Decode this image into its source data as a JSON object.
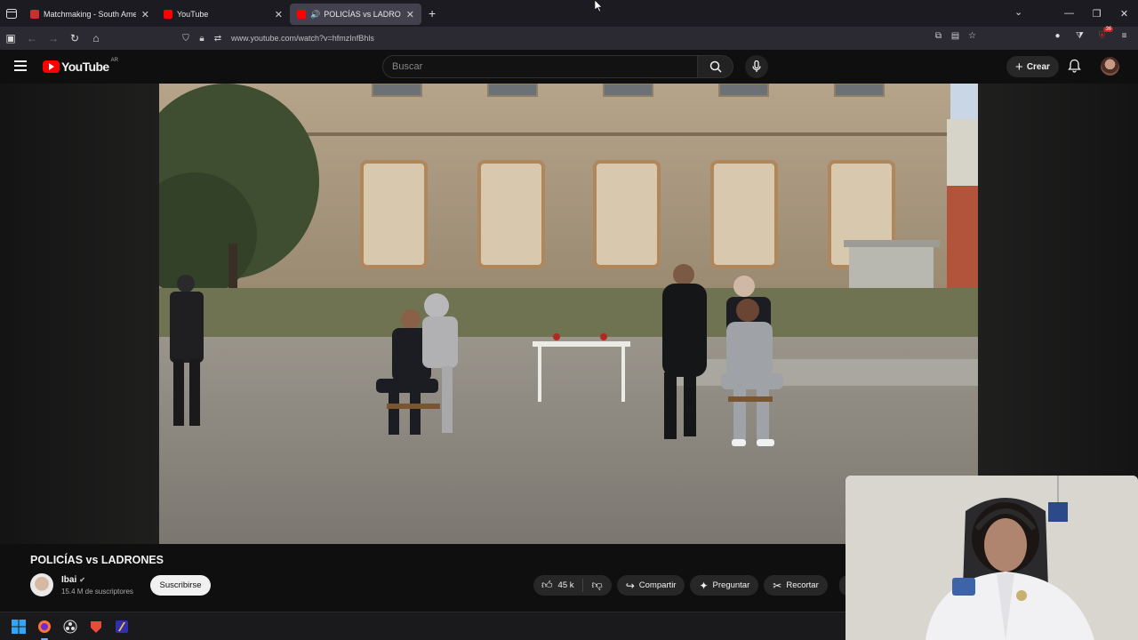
{
  "browser": {
    "tabs": [
      {
        "title": "Matchmaking - South America",
        "favicon_color": "#c82f2f",
        "active": false
      },
      {
        "title": "YouTube",
        "favicon_color": "#ff0000",
        "active": false
      },
      {
        "title": "POLICÍAS vs LADRONES - Y",
        "favicon_color": "#ff0000",
        "active": true,
        "playing_audio": true
      }
    ],
    "url": "www.youtube.com/watch?v=hfmzInfBhls",
    "extension_badge": "36"
  },
  "youtube": {
    "logo_text": "YouTube",
    "country_code": "AR",
    "search_placeholder": "Buscar",
    "create_label": "Crear"
  },
  "video": {
    "title": "POLICÍAS vs LADRONES",
    "channel": {
      "name": "Ibai",
      "subscribers": "15.4 M de suscriptores",
      "subscribe_label": "Suscribirse"
    },
    "actions": {
      "likes": "45 k",
      "share": "Compartir",
      "ask": "Preguntar",
      "clip": "Recortar"
    }
  },
  "colors": {
    "accent": "#ff0000",
    "background": "#0f0f0f",
    "pill": "#272727"
  }
}
